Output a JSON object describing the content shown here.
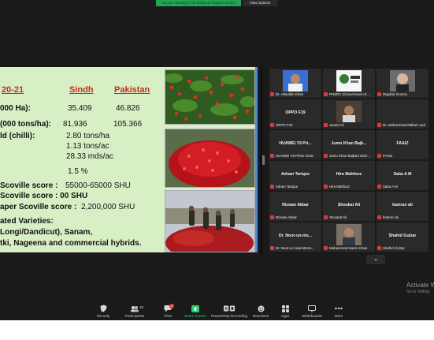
{
  "top_banner": {
    "text": "You are viewing Dr M Siddique Dogar's screen",
    "view_options": "View Options"
  },
  "slide": {
    "headers": {
      "period": "20-21",
      "sindh": "Sindh",
      "pakistan": "Pakistan"
    },
    "rows": [
      {
        "label": "000 Ha):",
        "sindh": "35.409",
        "pakistan": "46.826"
      },
      {
        "label": "(000 tons/ha):",
        "sindh": "81.936",
        "pakistan": "105.366"
      },
      {
        "label": "ld (chilli):",
        "sindh": "2.80 tons/ha",
        "pakistan": ""
      }
    ],
    "yield_lines": [
      "1.13 tons/ac",
      "28.33 mds/ac"
    ],
    "percent": "1.5 %",
    "scoville": [
      {
        "label": "Scoville score :",
        "value": "55000-65000 SHU"
      },
      {
        "label": "Scoville score : 00 SHU",
        "value": ""
      },
      {
        "label": "aper Scoville score :",
        "value": "2,200,000 SHU"
      }
    ],
    "varieties": [
      "ated Varieties:",
      "Longi/Dandicut),  Sanam,",
      "tki, Nageena and commercial hybrids."
    ]
  },
  "gallery": [
    {
      "name": "",
      "label": "Dr. Attaullah Khan",
      "photo": "avatar-photo",
      "muted": true
    },
    {
      "name": "",
      "label": "PHSRC (Government of ...",
      "photo": "logo-photo",
      "muted": true
    },
    {
      "name": "",
      "label": "Mujahid Scoimo",
      "photo": "avatar-photo",
      "muted": true
    },
    {
      "name": "OPPO F19",
      "label": "OPPO F19",
      "muted": true
    },
    {
      "name": "",
      "label": "Javaid Ali",
      "photo": "avatar-photo",
      "muted": true
    },
    {
      "name": "",
      "label": "Dr. Muhammad Mithal Lund",
      "muted": true
    },
    {
      "name": "HUAWEI Y9 Pri...",
      "label": "HUAWEI Y9 Prime 2019",
      "muted": true
    },
    {
      "name": "Jumo Khan Bajk...",
      "label": "Jumo Khan Bajkani  SSO...",
      "muted": true
    },
    {
      "name": "FAAIZ",
      "label": "FAAIZ",
      "muted": true
    },
    {
      "name": "Adnan Tarique",
      "label": "Adnan Tarique",
      "muted": true
    },
    {
      "name": "Hira Mahfooz",
      "label": "Hira Mahfooz",
      "muted": true
    },
    {
      "name": "Saba A M",
      "label": "Saba A M",
      "muted": true
    },
    {
      "name": "Rizwan Akbar",
      "label": "Rizwan Akbar",
      "muted": true
    },
    {
      "name": "Shoukat Ali",
      "label": "Shoukat Ali",
      "muted": true
    },
    {
      "name": "kamran ali",
      "label": "kamran ali",
      "muted": true
    },
    {
      "name": "Dr. Noor-un-nis...",
      "label": "Dr. Noor-un-nisa Memo...",
      "muted": true
    },
    {
      "name": "",
      "label": "Muhammad Nazim Khan",
      "photo": "avatar-photo",
      "muted": true
    },
    {
      "name": "Shahid Gulzar",
      "label": "Shahid Gulzar",
      "muted": true
    }
  ],
  "watermark": {
    "line1": "Activate Wi",
    "line2": "Go to Setting"
  },
  "toolbar": [
    {
      "label": "Security",
      "icon": "shield-icon"
    },
    {
      "label": "Participants",
      "icon": "participants-icon",
      "count": "18"
    },
    {
      "label": "Chat",
      "icon": "chat-icon",
      "badge": "5"
    },
    {
      "label": "Share Screen",
      "icon": "share-screen-icon"
    },
    {
      "label": "Pause/Stop Recording",
      "icon": "pause-stop-icon"
    },
    {
      "label": "Reactions",
      "icon": "reactions-icon"
    },
    {
      "label": "Apps",
      "icon": "apps-icon"
    },
    {
      "label": "Whiteboards",
      "icon": "whiteboard-icon"
    },
    {
      "label": "More",
      "icon": "more-icon"
    }
  ],
  "colors": {
    "accent_green": "#23a455",
    "share_green": "#2ecc71",
    "mic_red": "#d83a3a",
    "slide_bg": "#d8efc5",
    "header_red": "#c0301f"
  }
}
